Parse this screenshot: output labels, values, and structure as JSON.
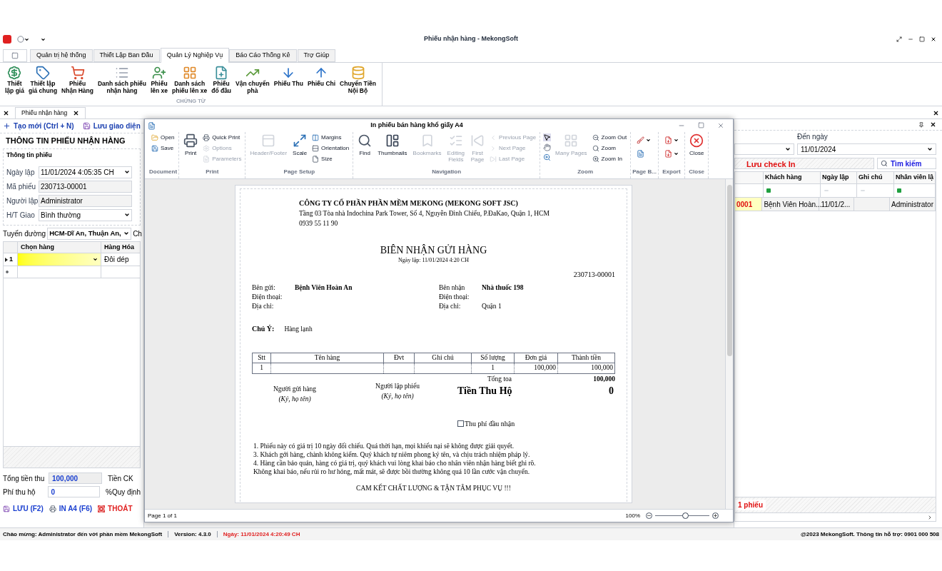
{
  "window": {
    "title": "Phiếu nhận hàng - MekongSoft"
  },
  "ribbon": {
    "tabs": [
      {
        "label": "Quản trị hệ thống",
        "selected": false
      },
      {
        "label": "Thiết Lập Ban Đầu",
        "selected": false
      },
      {
        "label": "Quản Lý Nghiệp Vụ",
        "selected": true
      },
      {
        "label": "Báo Cáo Thống Kê",
        "selected": false
      },
      {
        "label": "Trợ Giúp",
        "selected": false
      }
    ],
    "group": "CHỨNG TỪ",
    "buttons": [
      "Thiết\nlập giá",
      "Thiết lập\ngiá chung",
      "Phiếu\nNhận Hàng",
      "Danh sách phiếu\nnhận hàng",
      "Phiếu\nlên xe",
      "Danh sách\nphiếu lên xe",
      "Phiếu\nđổ đầu",
      "Vận chuyển\nphà",
      "Phiếu Thu",
      "Phiếu Chi",
      "Chuyển Tiền\nNội Bộ"
    ]
  },
  "doc_tab": "Phiếu nhận hàng",
  "left_panel": {
    "toolbar": [
      "Tạo mới (Ctrl + N)",
      "Lưu giao diện"
    ],
    "title": "THÔNG TIN PHIẾU NHẬN HÀNG",
    "section": "Thông tin phiếu",
    "fields": [
      {
        "label": "Ngày lập",
        "value": "11/01/2024 4:05:35 CH",
        "kind": "combo"
      },
      {
        "label": "Mã phiếu",
        "value": "230713-00001",
        "kind": "readonly"
      },
      {
        "label": "Người lập",
        "value": "Administrator",
        "kind": "readonly"
      },
      {
        "label": "H/T Giao",
        "value": "Bình thường",
        "kind": "combo"
      }
    ],
    "route": {
      "label": "Tuyến đường",
      "value": "HCM-Dĩ An, Thuận An,",
      "next_label": "Ch"
    },
    "grid": {
      "columns": [
        "Chọn hàng",
        "Hàng Hóa"
      ],
      "rows": [
        {
          "indicator": "1",
          "cells": [
            "",
            "Đôi dép"
          ]
        }
      ]
    },
    "totals": [
      {
        "label": "Tổng tiền thu",
        "value": "100,000",
        "next_label": "Tiền CK"
      },
      {
        "label": "Phí thu hộ",
        "value": "0",
        "next_label": "%Quy định"
      }
    ],
    "actions": [
      "LƯU (F2)",
      "IN A4 (F6)",
      "THOÁT"
    ]
  },
  "right_panel": {
    "date_label": "Đến ngày",
    "date_value": "11/01/2024",
    "save_button": "Lưu check In",
    "search_button": "Tìm kiếm",
    "columns": [
      "",
      "Khách hàng",
      "Ngày lập",
      "Ghi chú",
      "Nhân viên lậ"
    ],
    "rows": [
      [
        "0001",
        "Bệnh Viên Hoàn...",
        "11/01/2...",
        "",
        "Administrator"
      ]
    ],
    "footer": "1 phiếu"
  },
  "preview": {
    "title": "In phiếu bán hàng khổ giấy A4",
    "groups": [
      {
        "label": "Document",
        "items": [
          {
            "label": "Open",
            "kind": "small",
            "disabled": false
          },
          {
            "label": "Save",
            "kind": "small",
            "disabled": false
          }
        ]
      },
      {
        "label": "Print",
        "items": [
          {
            "label": "Print",
            "kind": "large",
            "disabled": false
          },
          {
            "label": "Quick Print",
            "kind": "small",
            "disabled": false
          },
          {
            "label": "Options",
            "kind": "small",
            "disabled": true
          },
          {
            "label": "Parameters",
            "kind": "small",
            "disabled": true
          }
        ]
      },
      {
        "label": "Page Setup",
        "items": [
          {
            "label": "Header/Footer",
            "kind": "large",
            "disabled": true
          },
          {
            "label": "Scale",
            "kind": "large",
            "disabled": false
          },
          {
            "label": "Margins",
            "kind": "small",
            "disabled": false
          },
          {
            "label": "Orientation",
            "kind": "small",
            "disabled": false
          },
          {
            "label": "Size",
            "kind": "small",
            "disabled": false
          }
        ]
      },
      {
        "label": "Navigation",
        "items": [
          {
            "label": "Find",
            "kind": "large",
            "disabled": false
          },
          {
            "label": "Thumbnails",
            "kind": "large",
            "disabled": false
          },
          {
            "label": "Bookmarks",
            "kind": "large",
            "disabled": true
          },
          {
            "label": "Editing\nFields",
            "kind": "large",
            "disabled": true
          },
          {
            "label": "First\nPage",
            "kind": "large",
            "disabled": true
          },
          {
            "label": "Previous Page",
            "kind": "small",
            "disabled": true
          },
          {
            "label": "Next Page",
            "kind": "small",
            "disabled": true
          },
          {
            "label": "Last Page",
            "kind": "small",
            "disabled": true
          }
        ]
      },
      {
        "label": "Zoom",
        "items": [
          {
            "kind": "tool"
          },
          {
            "label": "Many Pages",
            "kind": "large",
            "disabled": true
          },
          {
            "label": "Zoom Out",
            "kind": "small",
            "disabled": false
          },
          {
            "label": "Zoom",
            "kind": "small",
            "disabled": false
          },
          {
            "label": "Zoom In",
            "kind": "small",
            "disabled": false
          }
        ]
      },
      {
        "label": "Page B...",
        "items": [
          {
            "kind": "pair"
          }
        ]
      },
      {
        "label": "Export",
        "items": [
          {
            "kind": "pair"
          }
        ]
      },
      {
        "label": "Close",
        "items": [
          {
            "label": "Close",
            "kind": "large",
            "disabled": false
          }
        ]
      }
    ],
    "page_status": "Page 1 of 1",
    "zoom_reading": "100%",
    "zoom": {
      "level": 0.55
    },
    "document": {
      "company": "CÔNG TY CỔ PHẦN PHẦN MỀM MEKONG (MEKONG SOFT JSC)",
      "address": "Tầng 03 Tòa nhà Indochina Park Tower, Số 4, Nguyễn Đình Chiểu, P.ĐaKao, Quận 1, HCM",
      "phone": "0939 55 11 90",
      "title": "BIÊN NHẬN GỬI HÀNG",
      "date": "Ngày lập: 11/01/2024  4:20 CH",
      "code": "230713-00001",
      "sender": [
        {
          "label": "Bên gửi:",
          "value": "Bệnh Viên Hoàn An"
        },
        {
          "label": "Điện thoại:"
        },
        {
          "label": "Địa chỉ:"
        }
      ],
      "receiver": [
        {
          "label": "Bên nhận",
          "value": "Nhà thuốc 198"
        },
        {
          "label": "Điện thoại:"
        },
        {
          "label": "Địa chỉ:",
          "value": "Quận 1"
        }
      ],
      "note_label": "Chú Ý:",
      "note": "Hàng lạnh",
      "columns": [
        "Stt",
        "Tên hàng",
        "Đvt",
        "Ghi chú",
        "Số lượng",
        "Đơn giá",
        "Thành tiền"
      ],
      "rows": [
        [
          "1",
          "",
          "",
          "",
          "1",
          "100,000",
          "100,000"
        ]
      ],
      "total_label": "Tổng toa",
      "total": "100,000",
      "signers": [
        {
          "title": "Người gửi hàng",
          "hint": "(Ký, họ tên)"
        },
        {
          "title": "Người lập phiếu",
          "hint": "(Ký, họ tên)"
        }
      ],
      "cod_label": "Tiền Thu Hộ",
      "cod": "0",
      "fee_check": {
        "label": "Thu phí đầu nhận",
        "checked": false
      },
      "terms": [
        "1. Phiếu này có giá trị 10 ngày đối chiếu. Quá thời hạn, mọi khiếu nại sẽ không được giải quyết.",
        "3. Khách gởi hàng, chành không kiểm. Quý khách tự niêm phong ký tên, và chịu trách nhiệm pháp lý.",
        "4. Hàng cần bảo quản, hàng có giá trị, quý khách vui lòng khai báo cho nhân viên nhận hàng biết ghi rõ.\nKhông khai báo, nếu rủi ro hư hỏng, mất mát, sẽ được bồi thường không quá 10 lần cước vận chuyển."
      ],
      "slogan": "CAM KẾT CHẤT LƯỢNG & TẬN TÂM PHỤC VỤ !!!"
    }
  },
  "status_bar": {
    "welcome": "Chào mừng: Administrator đến với phần mềm MekongSoft",
    "version": "Version: 4.3.0",
    "date": "Ngày: 11/01/2024 4:20:49 CH",
    "copyright": "@2023 MekongSoft. Thông tin hỗ trợ: 0901 000 508"
  }
}
